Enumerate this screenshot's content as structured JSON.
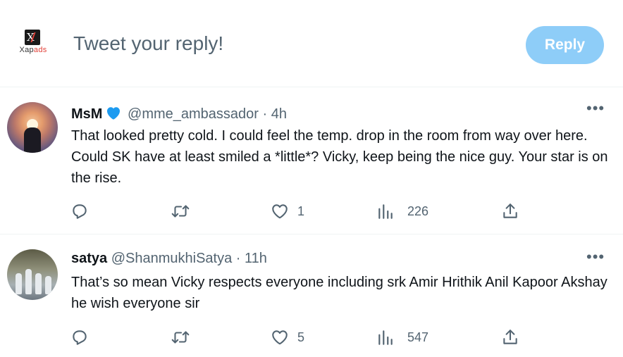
{
  "composer": {
    "brand_letters": "X",
    "brand_word_a": "Xap",
    "brand_word_b": "ads",
    "placeholder": "Tweet your reply!",
    "reply_label": "Reply"
  },
  "colors": {
    "accent": "#1d9bf0",
    "reply_disabled": "#8ecdf8",
    "secondary_text": "#536471",
    "divider": "#eff3f4"
  },
  "tweets": [
    {
      "name": "MsM",
      "verified": true,
      "handle": "@mme_ambassador",
      "separator": "·",
      "time": "4h",
      "more": "•••",
      "text": "That looked pretty cold.  I could feel the temp. drop in the room from way over here. Could SK have at least smiled a *little*? Vicky, keep being the nice guy. Your star is on the rise.",
      "likes": "1",
      "views": "226"
    },
    {
      "name": "satya",
      "verified": false,
      "handle": "@ShanmukhiSatya",
      "separator": "·",
      "time": "11h",
      "more": "•••",
      "text": "That’s so mean Vicky respects everyone including srk Amir Hrithik Anil Kapoor Akshay he wish everyone sir",
      "likes": "5",
      "views": "547"
    }
  ],
  "icons": {
    "reply": "reply-icon",
    "retweet": "retweet-icon",
    "like": "heart-icon",
    "views": "views-icon",
    "share": "share-icon",
    "verified": "verified-badge-icon",
    "more": "more-icon"
  }
}
